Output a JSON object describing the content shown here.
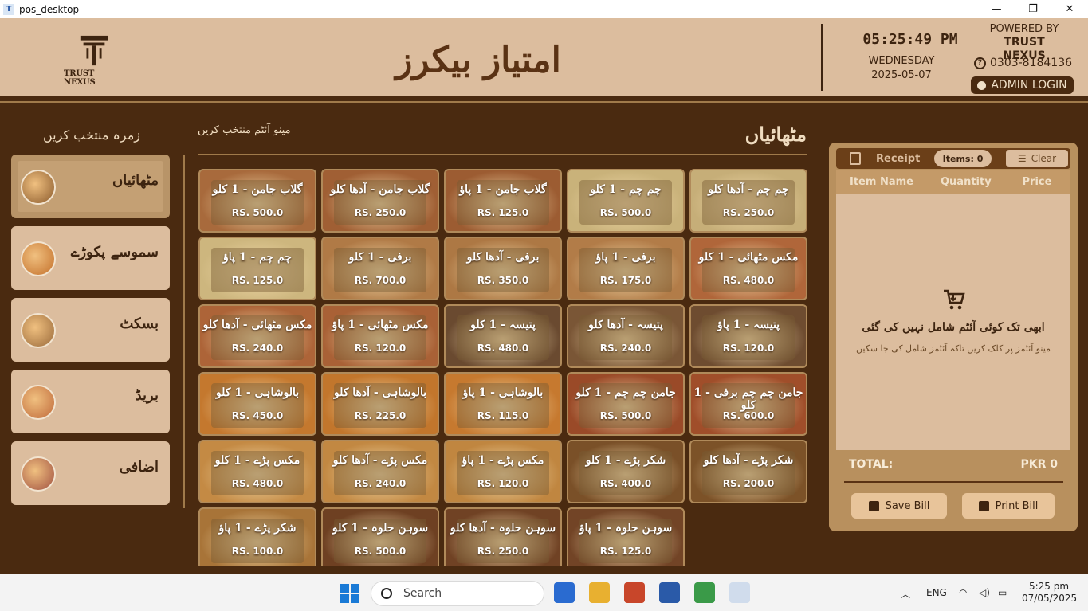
{
  "window": {
    "title": "pos_desktop",
    "minimize": "—",
    "maximize": "❐",
    "close": "✕"
  },
  "header": {
    "logo_text": "TRUST NEXUS",
    "shop_name": "امتیاز بیکرز",
    "time": "05:25:49 PM",
    "weekday": "WEDNESDAY",
    "date": "2025-05-07",
    "powered_by": "POWERED BY",
    "company": "TRUST NEXUS",
    "phone": "0303-8184136",
    "admin_login": "ADMIN LOGIN"
  },
  "categories": {
    "title": "زمرہ منتخب کریں",
    "items": [
      {
        "label": "مٹھائیاں",
        "active": true,
        "color": "#8a5a2c"
      },
      {
        "label": "سموسے پکوڑے",
        "active": false,
        "color": "#c4702a"
      },
      {
        "label": "بسکٹ",
        "active": false,
        "color": "#9a6a3a"
      },
      {
        "label": "بریڈ",
        "active": false,
        "color": "#c06a3a"
      },
      {
        "label": "اضافی",
        "active": false,
        "color": "#a05040"
      }
    ]
  },
  "menu": {
    "subtitle": "مینو آئٹم منتخب کریں",
    "title": "مٹھائیاں",
    "items": [
      {
        "name": "گلاب جامن - 1 کلو",
        "price": "RS. 500.0",
        "color": "#a86a3c"
      },
      {
        "name": "گلاب جامن - آدھا کلو",
        "price": "RS. 250.0",
        "color": "#a05f34"
      },
      {
        "name": "گلاب جامن - 1 پاؤ",
        "price": "RS. 125.0",
        "color": "#9c5c32"
      },
      {
        "name": "چم چم - 1 کلو",
        "price": "RS. 500.0",
        "color": "#c9b27a"
      },
      {
        "name": "چم چم - آدھا کلو",
        "price": "RS. 250.0",
        "color": "#c6ae78"
      },
      {
        "name": "چم چم - 1 پاؤ",
        "price": "RS. 125.0",
        "color": "#cdb67e"
      },
      {
        "name": "برفی - 1 کلو",
        "price": "RS. 700.0",
        "color": "#b07a46"
      },
      {
        "name": "برفی - آدھا کلو",
        "price": "RS. 350.0",
        "color": "#ad7844"
      },
      {
        "name": "برفی - 1 پاؤ",
        "price": "RS. 175.0",
        "color": "#b27c48"
      },
      {
        "name": "مکس مٹھائی - 1 کلو",
        "price": "RS. 480.0",
        "color": "#b0663a"
      },
      {
        "name": "مکس مٹھائی - آدھا کلو",
        "price": "RS. 240.0",
        "color": "#ad6438"
      },
      {
        "name": "مکس مٹھائی - 1 پاؤ",
        "price": "RS. 120.0",
        "color": "#a96136"
      },
      {
        "name": "پتیسہ - 1 کلو",
        "price": "RS. 480.0",
        "color": "#6a4a30"
      },
      {
        "name": "پتیسہ - آدھا کلو",
        "price": "RS. 240.0",
        "color": "#7a5636"
      },
      {
        "name": "پتیسہ - 1 پاؤ",
        "price": "RS. 120.0",
        "color": "#6e4c30"
      },
      {
        "name": "بالوشاہی - 1 کلو",
        "price": "RS. 450.0",
        "color": "#c4782e"
      },
      {
        "name": "بالوشاہی - آدھا کلو",
        "price": "RS. 225.0",
        "color": "#c2762c"
      },
      {
        "name": "بالوشاہی - 1 پاؤ",
        "price": "RS. 115.0",
        "color": "#c6792f"
      },
      {
        "name": "جامن چم چم - 1 کلو",
        "price": "RS. 500.0",
        "color": "#9a4a28"
      },
      {
        "name": "جامن چم چم برفی - 1 کلو",
        "price": "RS. 600.0",
        "color": "#a04e2a"
      },
      {
        "name": "مکس پڑے - 1 کلو",
        "price": "RS. 480.0",
        "color": "#c48a44"
      },
      {
        "name": "مکس پڑے - آدھا کلو",
        "price": "RS. 240.0",
        "color": "#c28842"
      },
      {
        "name": "مکس پڑے - 1 پاؤ",
        "price": "RS. 120.0",
        "color": "#c08640"
      },
      {
        "name": "شکر پڑے - 1 کلو",
        "price": "RS. 400.0",
        "color": "#7a5028"
      },
      {
        "name": "شکر پڑے - آدھا کلو",
        "price": "RS. 200.0",
        "color": "#7c5228"
      },
      {
        "name": "شکر پڑے - 1 پاؤ",
        "price": "RS. 100.0",
        "color": "#a87438"
      },
      {
        "name": "سوہن حلوہ - 1 کلو",
        "price": "RS. 500.0",
        "color": "#6e4022"
      },
      {
        "name": "سوہن حلوہ - آدھا کلو",
        "price": "RS. 250.0",
        "color": "#704224"
      },
      {
        "name": "سوہن حلوہ - 1 پاؤ",
        "price": "RS. 125.0",
        "color": "#724426"
      }
    ]
  },
  "receipt": {
    "title": "Receipt",
    "items_count": "Items: 0",
    "clear": "Clear",
    "columns": [
      "Item Name",
      "Quantity",
      "Price"
    ],
    "empty_title": "ابھی تک کوئی آئٹم شامل نہیں کی گئی",
    "empty_hint": "مینو آئٹمز پر کلک کریں تاکہ آئٹمز شامل کی جا سکیں",
    "total_label": "TOTAL:",
    "total_value": "PKR 0",
    "save": "Save Bill",
    "print": "Print Bill"
  },
  "taskbar": {
    "search": "Search",
    "lang": "ENG",
    "time": "5:25 pm",
    "date": "07/05/2025",
    "apps": [
      {
        "name": "store",
        "color": "#2a6bd0"
      },
      {
        "name": "file-explorer",
        "color": "#e8b030"
      },
      {
        "name": "powerpoint",
        "color": "#c8462a"
      },
      {
        "name": "word",
        "color": "#2a5aa8"
      },
      {
        "name": "chrome",
        "color": "#3a9a48"
      },
      {
        "name": "pos-desktop",
        "color": "#d0dcec"
      }
    ]
  }
}
